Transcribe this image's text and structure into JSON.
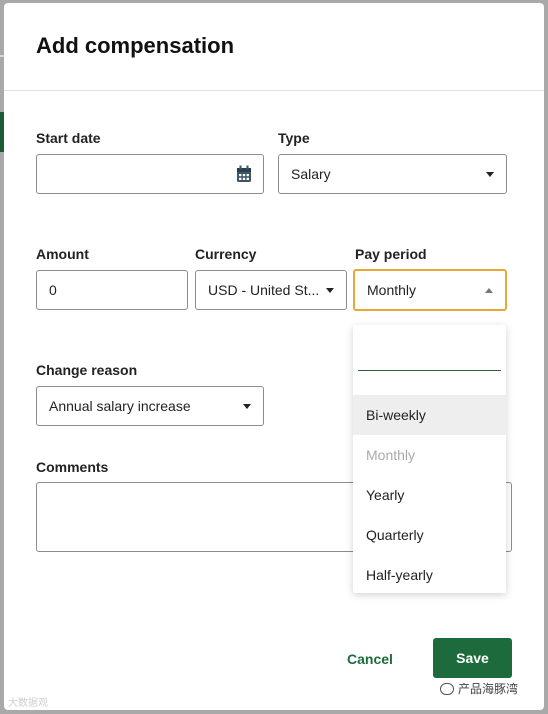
{
  "dialog": {
    "title": "Add compensation"
  },
  "form": {
    "start_date": {
      "label": "Start date",
      "value": ""
    },
    "type": {
      "label": "Type",
      "value": "Salary"
    },
    "amount": {
      "label": "Amount",
      "value": "0"
    },
    "currency": {
      "label": "Currency",
      "value": "USD - United St..."
    },
    "pay_period": {
      "label": "Pay period",
      "value": "Monthly"
    },
    "change_reason": {
      "label": "Change reason",
      "value": "Annual salary increase"
    },
    "comments": {
      "label": "Comments",
      "value": ""
    }
  },
  "pay_period_dropdown": {
    "search_value": "",
    "options": [
      "Bi-weekly",
      "Monthly",
      "Yearly",
      "Quarterly",
      "Half-yearly"
    ],
    "hovered": "Bi-weekly",
    "selected": "Monthly"
  },
  "actions": {
    "cancel_label": "Cancel",
    "save_label": "Save"
  },
  "colors": {
    "primary": "#1d6b3c",
    "focus_border": "#e8a838"
  },
  "watermarks": {
    "left": "大数据观",
    "right": "产品海豚湾"
  }
}
